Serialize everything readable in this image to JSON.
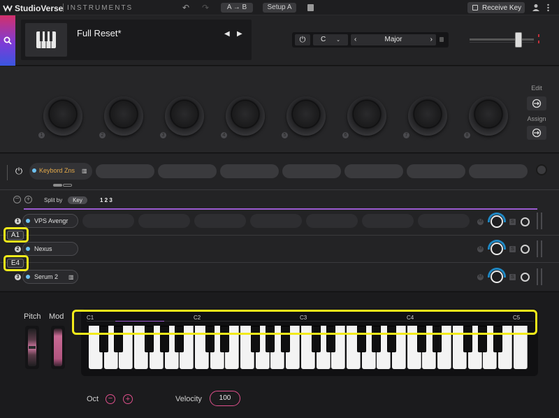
{
  "app": {
    "name": "StudioVerse",
    "section": "INSTRUMENTS"
  },
  "topbar": {
    "ab_label": "A → B",
    "setup_label": "Setup A",
    "receive_key_label": "Receive Key"
  },
  "preset": {
    "name": "Full Reset*"
  },
  "key_selector": {
    "key": "C",
    "scale": "Major"
  },
  "macros": {
    "numbers": [
      "1",
      "2",
      "3",
      "4",
      "5",
      "6",
      "7",
      "8"
    ],
    "edit_label": "Edit",
    "assign_label": "Assign"
  },
  "zones": {
    "keyboard_zones_label": "Keybord Zns",
    "split_by_label": "Split by",
    "split_mode": "Key",
    "zone_numbers": "1 2 3",
    "rows": [
      {
        "num": "1",
        "instrument": "VPS Avengr",
        "note": "A1"
      },
      {
        "num": "2",
        "instrument": "Nexus",
        "note": "E4"
      },
      {
        "num": "3",
        "instrument": "Serum 2",
        "note": ""
      }
    ],
    "mute_label": "M",
    "solo_label": "S"
  },
  "keyboard": {
    "pitch_label": "Pitch",
    "mod_label": "Mod",
    "octave_labels": [
      "C1",
      "C2",
      "C3",
      "C4",
      "C5"
    ],
    "oct_label": "Oct",
    "velocity_label": "Velocity",
    "velocity_value": "100"
  },
  "colors": {
    "accent_pink": "#e0508c",
    "accent_blue": "#1f88c4",
    "highlight": "#f2ea1a",
    "zone_line": "#9b5ad0"
  }
}
